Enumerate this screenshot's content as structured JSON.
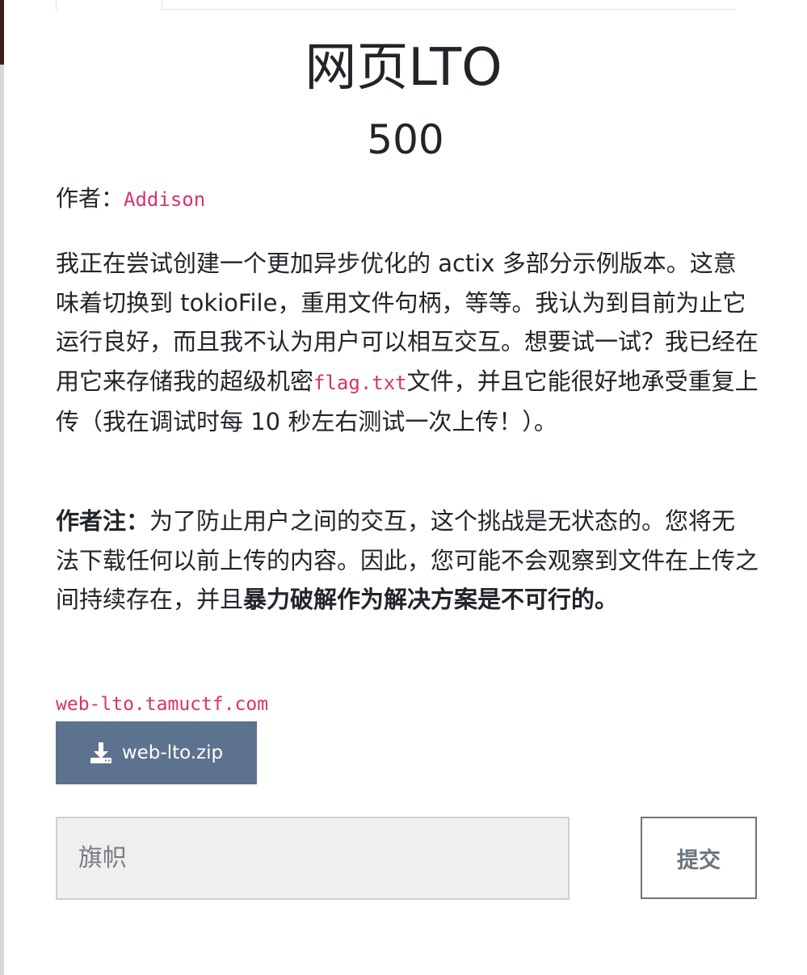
{
  "challenge": {
    "title": "网页LTO",
    "points": "500",
    "author_label": "作者：",
    "author_name": "Addison",
    "description": {
      "part1": "我正在尝试创建一个更加异步优化的 actix 多部分示例版本。这意味着切换到 tokioFile，重用文件句柄，等等。我认为到目前为止它运行良好，而且我不认为用户可以相互交互。想要试一试？我已经在用它来存储我的超级机密",
      "code": "flag.txt",
      "part2": "文件，并且它能很好地承受重复上传（我在调试时每 10 秒左右测试一次上传！）。"
    },
    "note": {
      "label": "作者注：",
      "text": "为了防止用户之间的交互，这个挑战是无状态的。您将无法下载任何以前上传的内容。因此，您可能不会观察到文件在上传之间持续存在，并且",
      "bold": "暴力破解作为解决方案是不可行的。"
    },
    "link": "web-lto.tamuctf.com",
    "download_label": "web-lto.zip",
    "flag_placeholder": "旗帜",
    "submit_label": "提交"
  },
  "colors": {
    "code": "#d6336c",
    "download_button": "#5d728f",
    "input_bg": "#efefef"
  },
  "icons": {
    "download": "download-icon"
  }
}
